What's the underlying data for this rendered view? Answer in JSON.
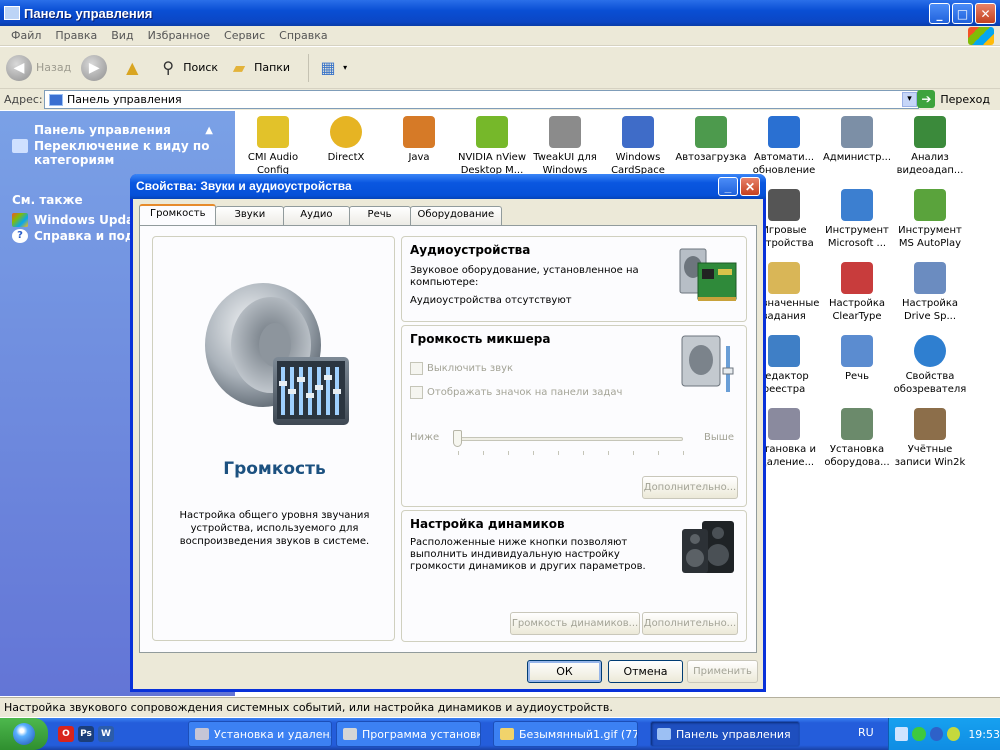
{
  "explorer": {
    "title": "Панель управления",
    "menu": [
      "Файл",
      "Правка",
      "Вид",
      "Избранное",
      "Сервис",
      "Справка"
    ],
    "toolbar": {
      "back": "Назад",
      "search": "Поиск",
      "folders": "Папки"
    },
    "address": {
      "label": "Адрес:",
      "value": "Панель управления",
      "go": "Переход"
    },
    "sidebar": {
      "panel_title": "Панель управления",
      "switch_link": "Переключение к виду по категориям",
      "see_also": "См. также",
      "links": [
        "Windows Updat",
        "Справка и подд"
      ]
    },
    "icons": [
      {
        "label": "CMI Audio Config",
        "color": "#e2c22a"
      },
      {
        "label": "DirectX",
        "color": "#e6b423"
      },
      {
        "label": "Java",
        "color": "#d67a27"
      },
      {
        "label": "NVIDIA nView Desktop M...",
        "color": "#76b82a"
      },
      {
        "label": "TweakUI для Windows",
        "color": "#8b8b8b"
      },
      {
        "label": "Windows CardSpace",
        "color": "#3f6cc8"
      },
      {
        "label": "Автозагрузка",
        "color": "#4d9a4d"
      },
      {
        "label": "Автомати... обновление",
        "color": "#2a70d2"
      },
      {
        "label": "Администр...",
        "color": "#7c8fa6"
      },
      {
        "label": "Анализ видеоадап...",
        "color": "#3b8a3b"
      },
      {
        "label": "Игровые устройства",
        "color": "#555"
      },
      {
        "label": "Инструмент Microsoft ...",
        "color": "#3c7fd0"
      },
      {
        "label": "Инструмент MS AutoPlay",
        "color": "#5aa33c"
      },
      {
        "label": "Назначенные задания",
        "color": "#d9b657"
      },
      {
        "label": "Настройка ClearType",
        "color": "#c83c3c"
      },
      {
        "label": "Настройка Drive Sp...",
        "color": "#6b8cc0"
      },
      {
        "label": "Редактор реестра",
        "color": "#3f7fc6"
      },
      {
        "label": "Речь",
        "color": "#5b8cd0"
      },
      {
        "label": "Свойства обозревателя",
        "color": "#2f7fd0"
      },
      {
        "label": "Установка и удаление...",
        "color": "#8a8a9e"
      },
      {
        "label": "Установка оборудова...",
        "color": "#6b8a6b"
      },
      {
        "label": "Учётные записи Win2k",
        "color": "#8c6e4a"
      }
    ],
    "status": "Настройка звукового сопровождения системных событий, или настройка динамиков и аудиоустройств."
  },
  "dialog": {
    "title": "Свойства: Звуки и аудиоустройства",
    "tabs": [
      "Громкость",
      "Звуки",
      "Аудио",
      "Речь",
      "Оборудование"
    ],
    "left": {
      "title": "Громкость",
      "desc": "Настройка общего уровня звучания устройства, используемого для воспроизведения звуков в системе."
    },
    "audio_devices": {
      "title": "Аудиоустройства",
      "desc": "Звуковое оборудование, установленное на компьютере:",
      "none": "Аудиоустройства отсутствуют"
    },
    "mixer": {
      "title": "Громкость микшера",
      "mute": "Выключить звук",
      "tray_icon": "Отображать значок на панели задач",
      "low": "Ниже",
      "high": "Выше",
      "advanced": "Дополнительно..."
    },
    "speakers": {
      "title": "Настройка динамиков",
      "desc": "Расположенные ниже кнопки позволяют выполнить индивидуальную настройку громкости динамиков и других параметров.",
      "volume": "Громкость динамиков...",
      "advanced": "Дополнительно..."
    },
    "buttons": {
      "ok": "ОК",
      "cancel": "Отмена",
      "apply": "Применить"
    }
  },
  "taskbar": {
    "tasks": [
      "Установка и удален...",
      "Программа установк...",
      "Безымянный1.gif (77...",
      "Панель управления"
    ],
    "lang": "RU",
    "time": "19:53"
  }
}
